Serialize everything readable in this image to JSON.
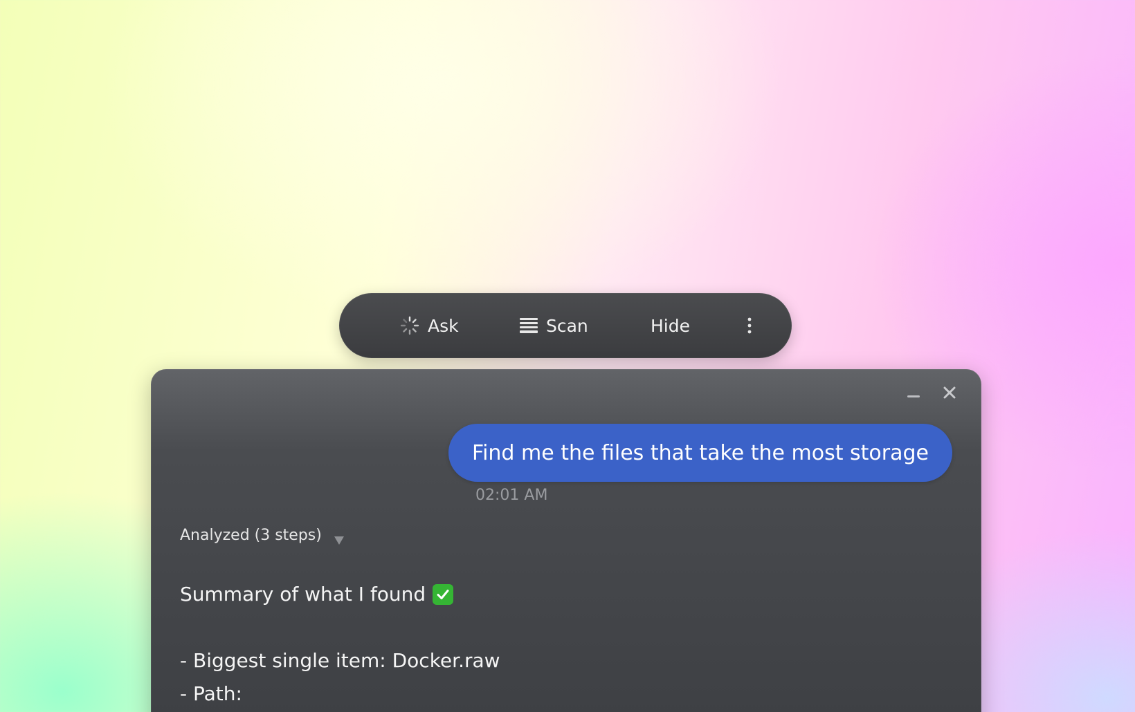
{
  "toolbar": {
    "ask_label": "Ask",
    "scan_label": "Scan",
    "hide_label": "Hide",
    "ask_icon": "spinner-icon",
    "scan_icon": "lines-icon",
    "more_icon": "more-vertical-icon"
  },
  "window": {
    "minimize_icon": "minimize-icon",
    "close_icon": "close-icon"
  },
  "chat": {
    "user_message": "Find me the files that take the most storage",
    "timestamp": "02:01 AM",
    "steps_label": "Analyzed (3 steps)",
    "answer": {
      "heading": "Summary of what I found",
      "heading_icon": "check-mark-button-icon",
      "items": [
        "- Biggest single item: Docker.raw",
        "- Path:"
      ]
    }
  },
  "colors": {
    "bubble": "#3b62c8",
    "panel": "#45474b",
    "toolbar": "#414245",
    "check": "#35b534"
  }
}
